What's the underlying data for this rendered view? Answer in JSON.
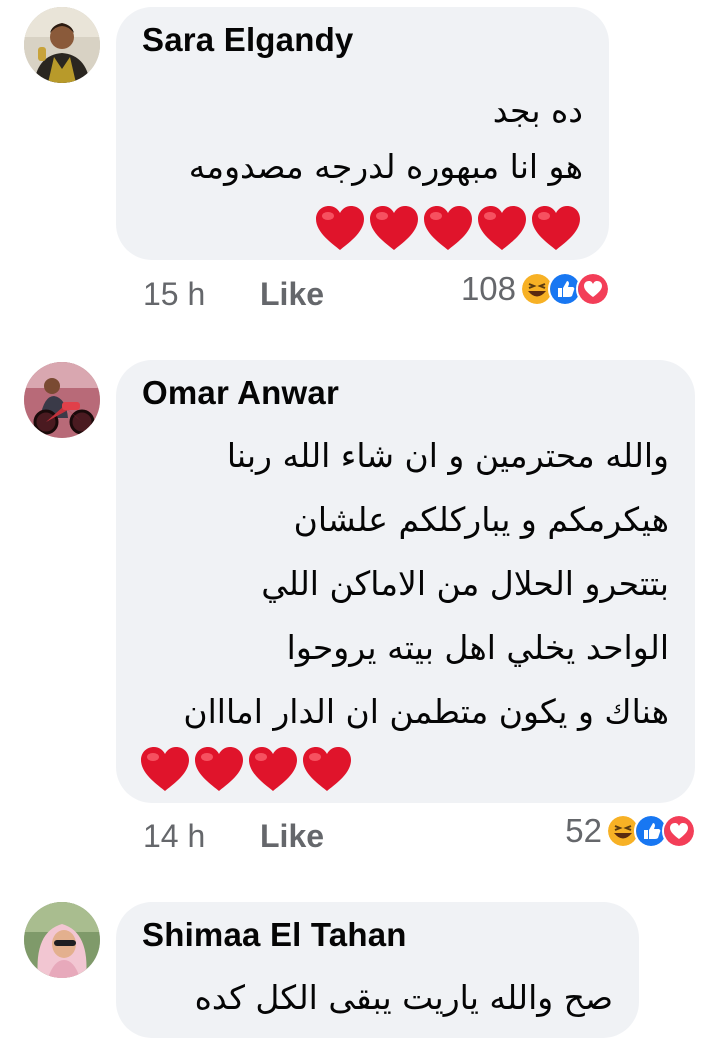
{
  "comments": [
    {
      "author": "Sara Elgandy",
      "lines": [
        "ده بجد",
        "هو انا مبهوره لدرجه مصدومه"
      ],
      "heart_count": 5,
      "time": "15 h",
      "like_label": "Like",
      "reaction_count": "108",
      "reaction_icons": [
        "haha-icon",
        "like-icon",
        "love-icon"
      ]
    },
    {
      "author": "Omar Anwar",
      "lines": [
        "والله محترمين و ان شاء الله ربنا",
        "هيكرمكم و يباركلكم علشان",
        "بتتحرو الحلال من الاماكن اللي",
        "الواحد يخلي اهل بيته يروحوا",
        "هناك و يكون متطمن ان الدار امااان"
      ],
      "heart_count": 4,
      "time": "14 h",
      "like_label": "Like",
      "reaction_count": "52",
      "reaction_icons": [
        "haha-icon",
        "like-icon",
        "love-icon"
      ]
    },
    {
      "author": "Shimaa El Tahan",
      "lines": [
        "صح والله ياريت يبقى الكل كده"
      ]
    }
  ],
  "colors": {
    "bubble": "#f0f2f5",
    "heart": "#e0142b",
    "like_blue": "#1877f2",
    "love_red": "#f33e58",
    "haha_yellow": "#f7b125",
    "meta_gray": "#65676b"
  }
}
